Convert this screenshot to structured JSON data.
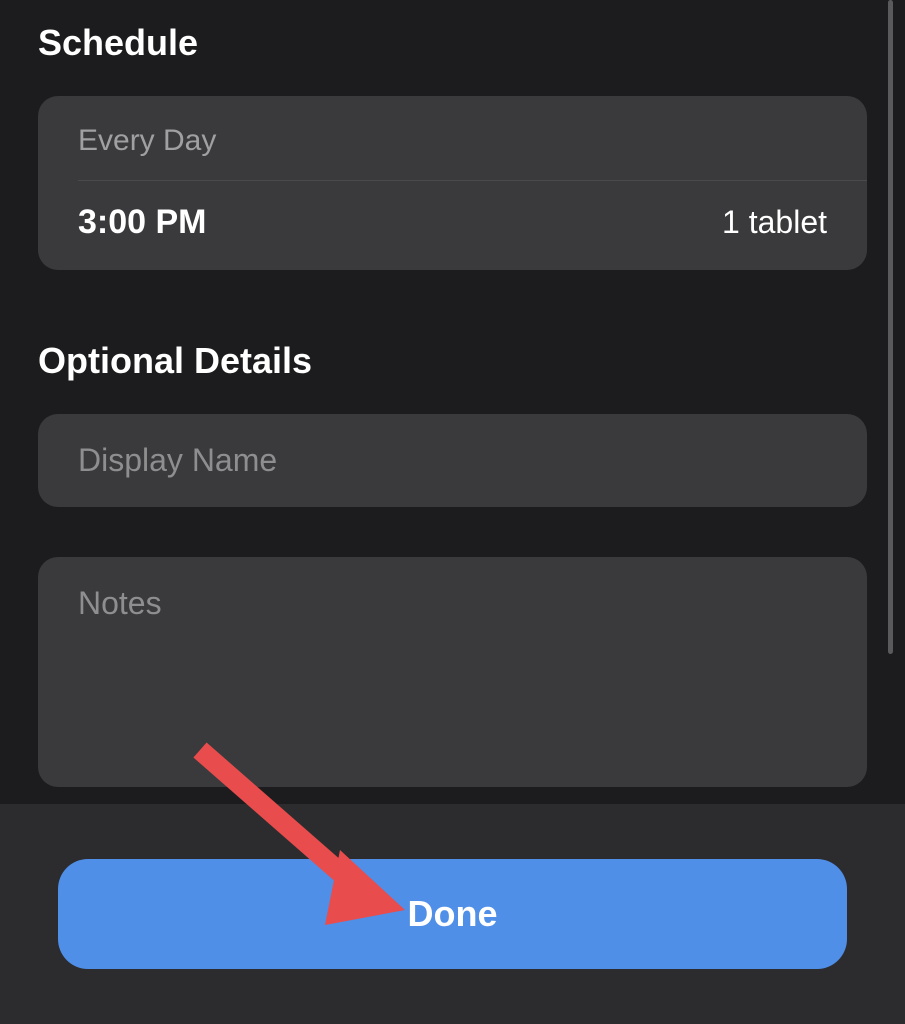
{
  "schedule": {
    "title": "Schedule",
    "frequency": "Every Day",
    "time": "3:00 PM",
    "dose": "1 tablet"
  },
  "optional": {
    "title": "Optional Details",
    "displayNamePlaceholder": "Display Name",
    "notesPlaceholder": "Notes"
  },
  "footer": {
    "doneLabel": "Done"
  }
}
